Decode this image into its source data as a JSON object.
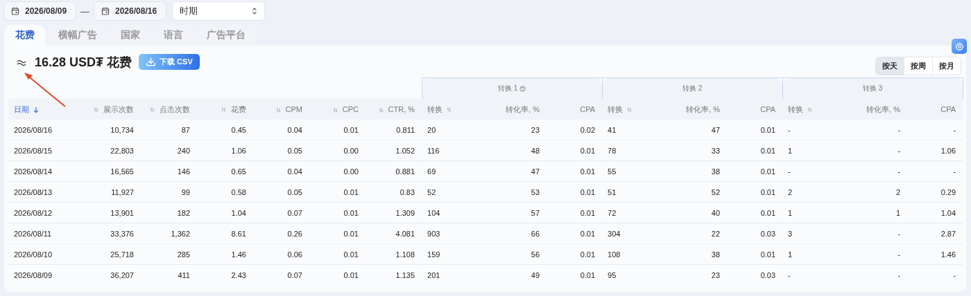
{
  "filters": {
    "date_from": "2026/08/09",
    "separator": "—",
    "date_to": "2026/08/16",
    "period": "时期"
  },
  "tabs": [
    {
      "label": "花费",
      "selected": true
    },
    {
      "label": "横幅广告",
      "selected": false
    },
    {
      "label": "国家",
      "selected": false
    },
    {
      "label": "语言",
      "selected": false
    },
    {
      "label": "广告平台",
      "selected": false
    }
  ],
  "summary": {
    "title": "16.28 USD₮ 花费",
    "download_button": "下载 CSV"
  },
  "granularity": [
    {
      "label": "按天",
      "selected": true
    },
    {
      "label": "按周",
      "selected": false
    },
    {
      "label": "按月",
      "selected": false
    }
  ],
  "column_groups": [
    {
      "label": "转换 1",
      "help": true
    },
    {
      "label": "转换 2",
      "help": false
    },
    {
      "label": "转换 3",
      "help": false
    }
  ],
  "columns": [
    {
      "label": "日期",
      "sorted": true
    },
    {
      "label": "展示次数",
      "sortable": true,
      "sorted": false
    },
    {
      "label": "点击次数",
      "sortable": true,
      "sorted": false
    },
    {
      "label": "花费",
      "sortable": true,
      "sorted": false
    },
    {
      "label": "CPM",
      "sortable": true,
      "sorted": false
    },
    {
      "label": "CPC",
      "sortable": true,
      "sorted": false
    },
    {
      "label": "CTR, %",
      "sortable": true,
      "sorted": false
    },
    {
      "label": "转换",
      "sortable": true,
      "sorted": false
    },
    {
      "label": "转化率, %",
      "sortable": false,
      "sorted": false
    },
    {
      "label": "CPA",
      "sortable": false,
      "sorted": false
    },
    {
      "label": "转换",
      "sortable": true,
      "sorted": false
    },
    {
      "label": "转化率, %",
      "sortable": false,
      "sorted": false
    },
    {
      "label": "CPA",
      "sortable": false,
      "sorted": false
    },
    {
      "label": "转换",
      "sortable": true,
      "sorted": false
    },
    {
      "label": "转化率, %",
      "sortable": false,
      "sorted": false
    },
    {
      "label": "CPA",
      "sortable": false,
      "sorted": false
    }
  ],
  "rows": [
    [
      "2026/08/16",
      "10,734",
      "87",
      "0.45",
      "0.04",
      "0.01",
      "0.811",
      "20",
      "23",
      "0.02",
      "41",
      "47",
      "0.01",
      "-",
      "-",
      "-"
    ],
    [
      "2026/08/15",
      "22,803",
      "240",
      "1.06",
      "0.05",
      "0.00",
      "1.052",
      "116",
      "48",
      "0.01",
      "78",
      "33",
      "0.01",
      "1",
      "-",
      "1.06"
    ],
    [
      "2026/08/14",
      "16,565",
      "146",
      "0.65",
      "0.04",
      "0.00",
      "0.881",
      "69",
      "47",
      "0.01",
      "55",
      "38",
      "0.01",
      "-",
      "-",
      "-"
    ],
    [
      "2026/08/13",
      "11,927",
      "99",
      "0.58",
      "0.05",
      "0.01",
      "0.83",
      "52",
      "53",
      "0.01",
      "51",
      "52",
      "0.01",
      "2",
      "2",
      "0.29"
    ],
    [
      "2026/08/12",
      "13,901",
      "182",
      "1.04",
      "0.07",
      "0.01",
      "1.309",
      "104",
      "57",
      "0.01",
      "72",
      "40",
      "0.01",
      "1",
      "1",
      "1.04"
    ],
    [
      "2026/08/11",
      "33,376",
      "1,362",
      "8.61",
      "0.26",
      "0.01",
      "4.081",
      "903",
      "66",
      "0.01",
      "304",
      "22",
      "0.03",
      "3",
      "-",
      "2.87"
    ],
    [
      "2026/08/10",
      "25,718",
      "285",
      "1.46",
      "0.06",
      "0.01",
      "1.108",
      "159",
      "56",
      "0.01",
      "108",
      "38",
      "0.01",
      "1",
      "-",
      "1.46"
    ],
    [
      "2026/08/09",
      "36,207",
      "411",
      "2.43",
      "0.07",
      "0.01",
      "1.135",
      "201",
      "49",
      "0.01",
      "95",
      "23",
      "0.03",
      "-",
      "-",
      "-"
    ]
  ]
}
